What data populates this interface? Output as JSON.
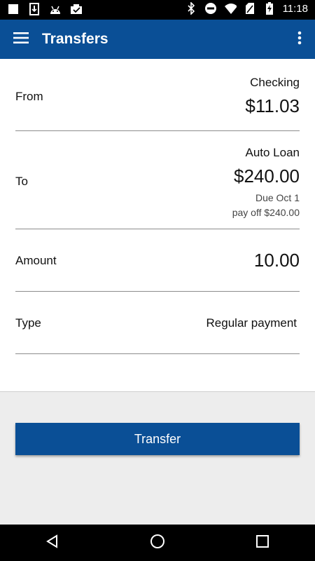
{
  "status_bar": {
    "time": "11:18",
    "left_icons": [
      "notification-square-icon",
      "download-icon",
      "android-icon",
      "photo-check-icon"
    ],
    "right_icons": [
      "bluetooth-icon",
      "do-not-disturb-icon",
      "wifi-icon",
      "no-sim-icon",
      "battery-charging-icon"
    ]
  },
  "app_bar": {
    "title": "Transfers",
    "menu_icon": "hamburger-menu-icon",
    "overflow_icon": "more-vert-icon",
    "color": "#0a4f96"
  },
  "form": {
    "from": {
      "label": "From",
      "account": "Checking",
      "balance": "$11.03"
    },
    "to": {
      "label": "To",
      "account": "Auto Loan",
      "balance": "$240.00",
      "due": "Due Oct 1",
      "payoff": "pay off $240.00"
    },
    "amount": {
      "label": "Amount",
      "value": "10.00"
    },
    "type": {
      "label": "Type",
      "value": "Regular payment"
    }
  },
  "actions": {
    "transfer_label": "Transfer"
  },
  "nav_bar": {
    "icons": [
      "back-icon",
      "home-icon",
      "recents-icon"
    ]
  }
}
